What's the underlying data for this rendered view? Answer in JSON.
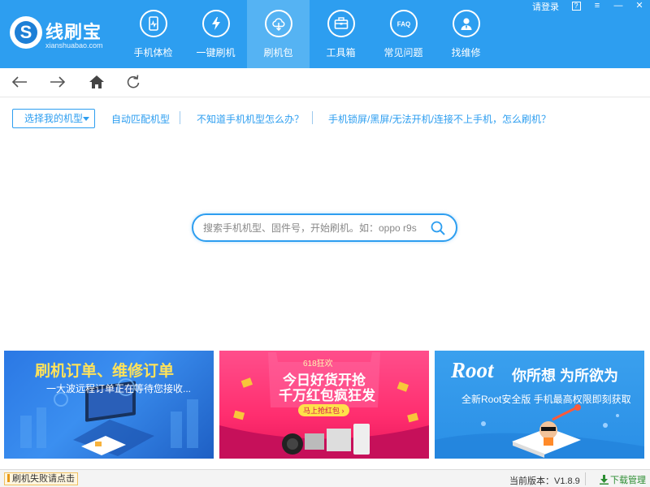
{
  "app": {
    "logo_title": "线刷宝",
    "logo_sub": "xianshuabao.com",
    "logo_letter": "S"
  },
  "topbar": {
    "login": "请登录",
    "help": "?",
    "menu_icon": "≡",
    "minimize": "—",
    "close": "✕"
  },
  "nav": [
    {
      "label": "手机体检",
      "icon": "phone-check-icon",
      "active": false
    },
    {
      "label": "一键刷机",
      "icon": "lightning-icon",
      "active": false
    },
    {
      "label": "刷机包",
      "icon": "cloud-package-icon",
      "active": true
    },
    {
      "label": "工具箱",
      "icon": "toolbox-icon",
      "active": false
    },
    {
      "label": "常见问题",
      "icon": "faq-icon",
      "active": false,
      "icon_text": "FAQ"
    },
    {
      "label": "找维修",
      "icon": "technician-icon",
      "active": false
    }
  ],
  "filters": {
    "select_label": "选择我的机型",
    "auto_match": "自动匹配机型",
    "unknown_model": "不知道手机机型怎么办？",
    "locked_screen": "手机锁屏/黑屏/无法开机/连接不上手机，怎么刷机？"
  },
  "search": {
    "placeholder": "搜索手机机型、固件号，开始刷机。如：oppo r9s"
  },
  "banners": [
    {
      "title": "刷机订单、维修订单",
      "subtitle": "一大波远程订单正在等待您接收..."
    },
    {
      "tag": "618狂欢",
      "title_line1": "今日好货开抢",
      "title_line2": "千万红包疯狂发",
      "button": "马上抢红包 ›"
    },
    {
      "title_en": "Root",
      "title_cn": "你所想 为所欲为",
      "subtitle": "全新Root安全版  手机最高权限即刻获取"
    }
  ],
  "status": {
    "fail_text": "刷机失败请点击",
    "version_label": "当前版本：V1.8.9",
    "download": "下载管理"
  },
  "colors": {
    "brand_blue": "#2d9ef0",
    "active_tab": "#55b3f3",
    "download_green": "#2c8d32"
  }
}
